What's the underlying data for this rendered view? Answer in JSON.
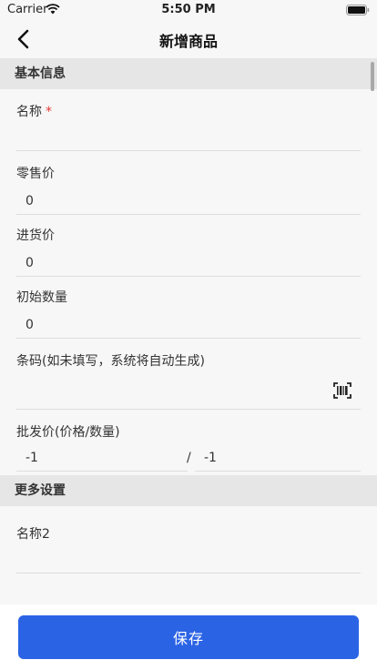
{
  "status_bar": {
    "carrier": "Carrier",
    "time": "5:50 PM"
  },
  "nav": {
    "title": "新增商品"
  },
  "sections": {
    "basic": "基本信息",
    "more": "更多设置"
  },
  "fields": {
    "name": {
      "label": "名称",
      "required_mark": "*",
      "value": ""
    },
    "retail_price": {
      "label": "零售价",
      "value": "0"
    },
    "purchase_price": {
      "label": "进货价",
      "value": "0"
    },
    "initial_quantity": {
      "label": "初始数量",
      "value": "0"
    },
    "barcode": {
      "label": "条码(如未填写，系统将自动生成)",
      "value": ""
    },
    "wholesale": {
      "label": "批发价(价格/数量)",
      "price": "-1",
      "separator": "/",
      "quantity": "-1"
    },
    "name2": {
      "label": "名称2",
      "value": ""
    }
  },
  "footer": {
    "save_label": "保存"
  },
  "colors": {
    "primary": "#2b63e5",
    "required": "#e53935",
    "section_bg": "#e6e6e6"
  },
  "icons": {
    "back": "chevron-left-icon",
    "barcode": "barcode-scan-icon",
    "wifi": "wifi-icon",
    "battery": "battery-icon"
  }
}
